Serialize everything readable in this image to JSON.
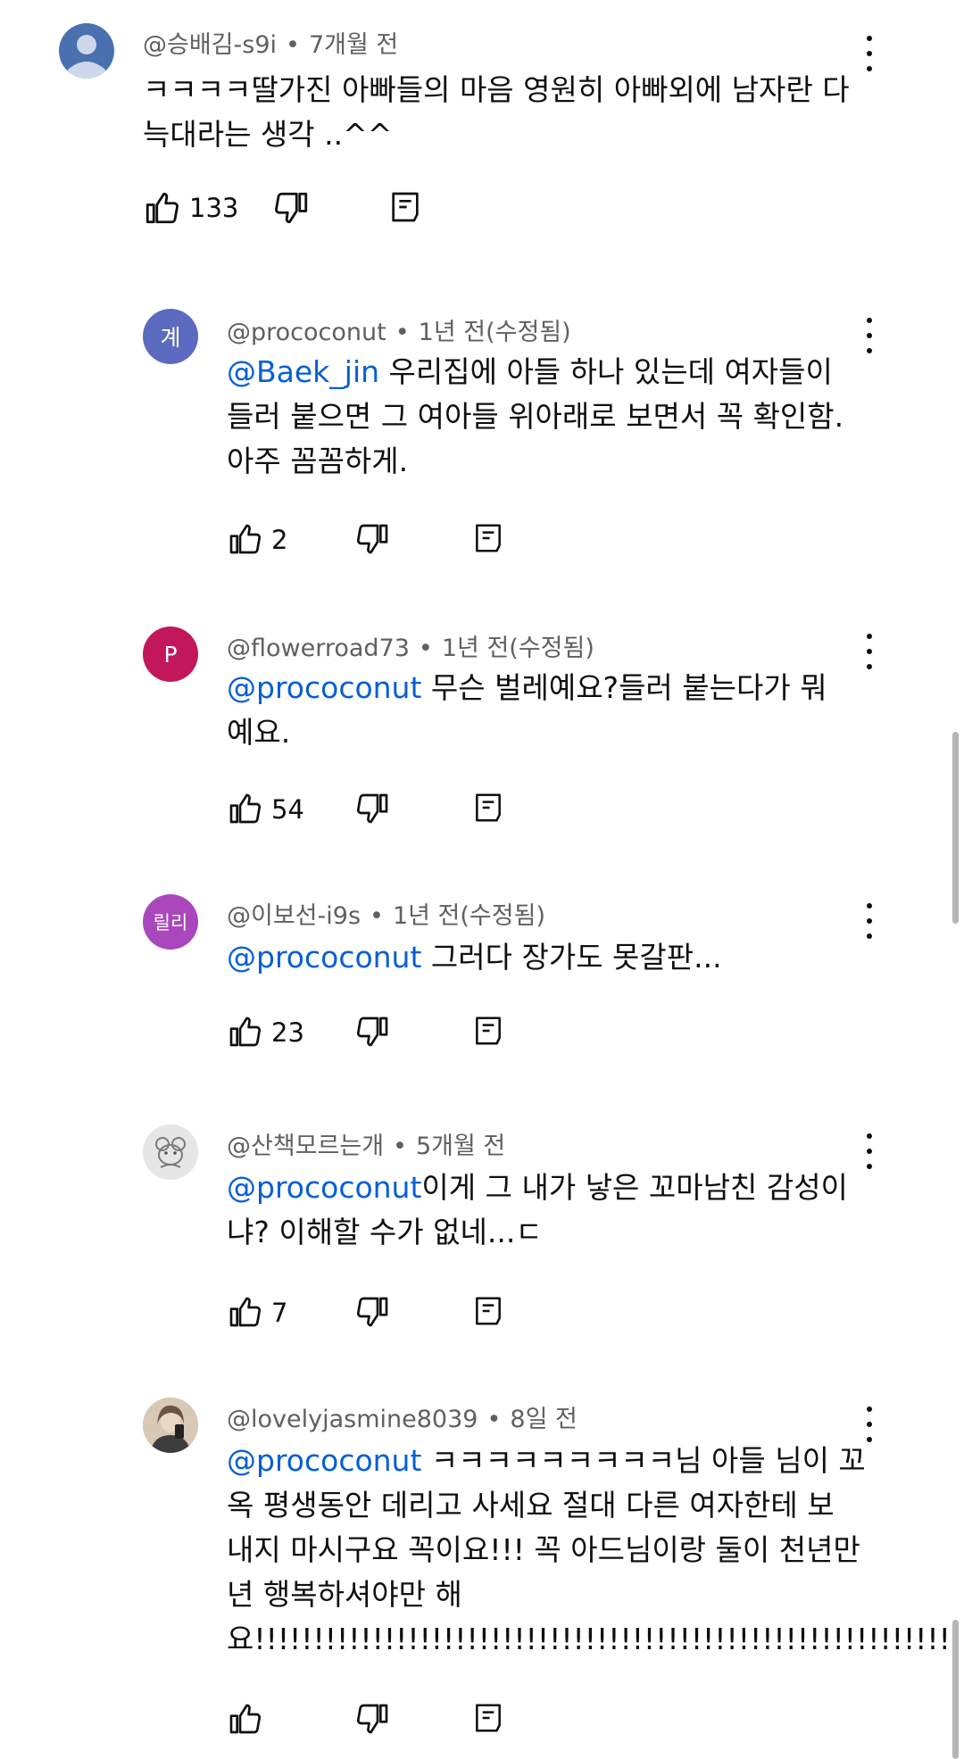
{
  "comments": [
    {
      "author": "@승배김-s9i",
      "time": "7개월 전",
      "text": "ㅋㅋㅋㅋ딸가진 아빠들의 마음 영원히 아빠외에 남자란 다\n늑대라는 생각 ..^^",
      "mention": "",
      "likes": "133",
      "avatar_label": "",
      "avatar_color": "#4a70b0"
    },
    {
      "author": "@prococonut",
      "time": "1년 전(수정됨)",
      "mention": "@Baek_jin",
      "text": " 우리집에 아들 하나 있는데 여자들이\n들러 붙으면 그 여아들 위아래로 보면서 꼭 확인함.\n아주 꼼꼼하게.",
      "likes": "2",
      "avatar_label": "계",
      "avatar_color": "#5c6bc0"
    },
    {
      "author": "@flowerroad73",
      "time": "1년 전(수정됨)",
      "mention": "@prococonut",
      "text": " 무슨 벌레예요?들러 붙는다가 뭐\n예요.",
      "likes": "54",
      "avatar_label": "P",
      "avatar_color": "#c2185b"
    },
    {
      "author": "@이보선-i9s",
      "time": "1년 전(수정됨)",
      "mention": "@prococonut",
      "text": " 그러다 장가도 못갈판...",
      "likes": "23",
      "avatar_label": "릴리",
      "avatar_color": "#ab47bc"
    },
    {
      "author": "@산책모르는개",
      "time": "5개월 전",
      "mention": "@prococonut",
      "text": "이게 그 내가 낳은 꼬마남친 감성이\n냐? 이해할 수가 없네...ㄷ",
      "likes": "7",
      "avatar_label": "",
      "avatar_color": "#d7d7d7"
    },
    {
      "author": "@lovelyjasmine8039",
      "time": "8일 전",
      "mention": "@prococonut",
      "text": " ㅋㅋㅋㅋㅋㅋㅋㅋㅋ님 아들 님이 꼬\n옥 평생동안 데리고 사세요 절대 다른 여자한테 보\n내지 마시구요 꼭이요!!! 꼭 아드님이랑 둘이 천년만\n년 행복하셔야만 해\n요!!!!!!!!!!!!!!!!!!!!!!!!!!!!!!!!!!!!!!!!!!!!!!!!!!!!!!!!!!!!",
      "likes": "",
      "avatar_label": "",
      "avatar_color": "#c9b8a6"
    }
  ],
  "icons": {
    "like": "thumbs-up-icon",
    "dislike": "thumbs-down-icon",
    "reply": "reply-icon",
    "more": "more-vertical-icon"
  },
  "colors": {
    "mention": "#065fd4",
    "meta": "#606060"
  }
}
